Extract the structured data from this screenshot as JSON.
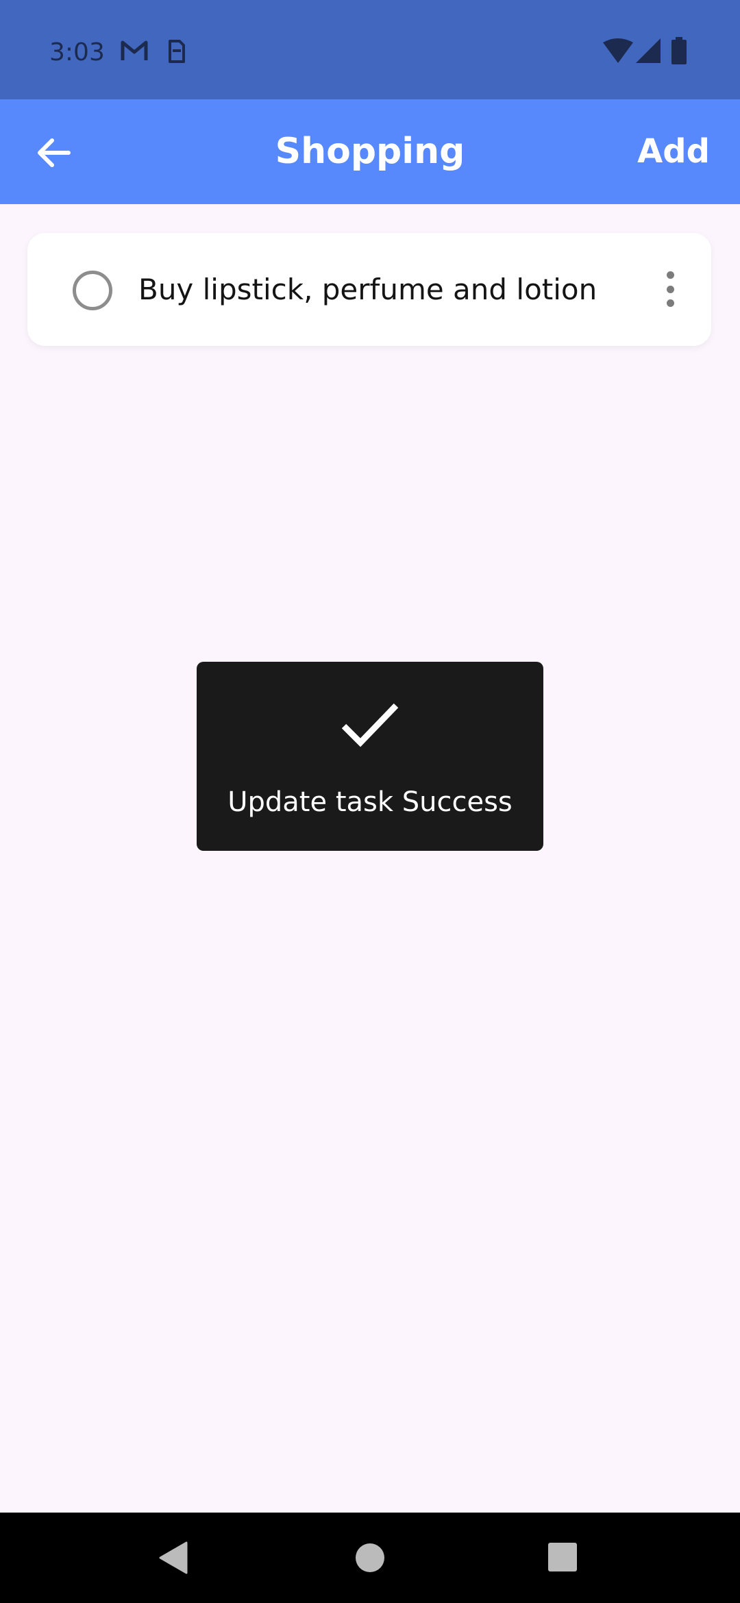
{
  "status_bar": {
    "time": "3:03",
    "left_icons": [
      "gmail-icon",
      "sim-icon"
    ],
    "right_icons": [
      "wifi-icon",
      "signal-icon",
      "battery-icon"
    ],
    "background": "#4267be"
  },
  "app_bar": {
    "title": "Shopping",
    "add_label": "Add",
    "back_icon": "arrow-left-icon",
    "background": "#5789fd"
  },
  "tasks": [
    {
      "label": "Buy lipstick, perfume and lotion",
      "completed": false,
      "menu_icon": "more-vertical-icon"
    }
  ],
  "toast": {
    "icon": "check-icon",
    "message": "Update task Success",
    "background": "#1a1a1a"
  },
  "nav_bar": {
    "buttons": [
      "back-triangle-icon",
      "home-circle-icon",
      "recents-square-icon"
    ]
  },
  "page_background": "#fcf5fd"
}
